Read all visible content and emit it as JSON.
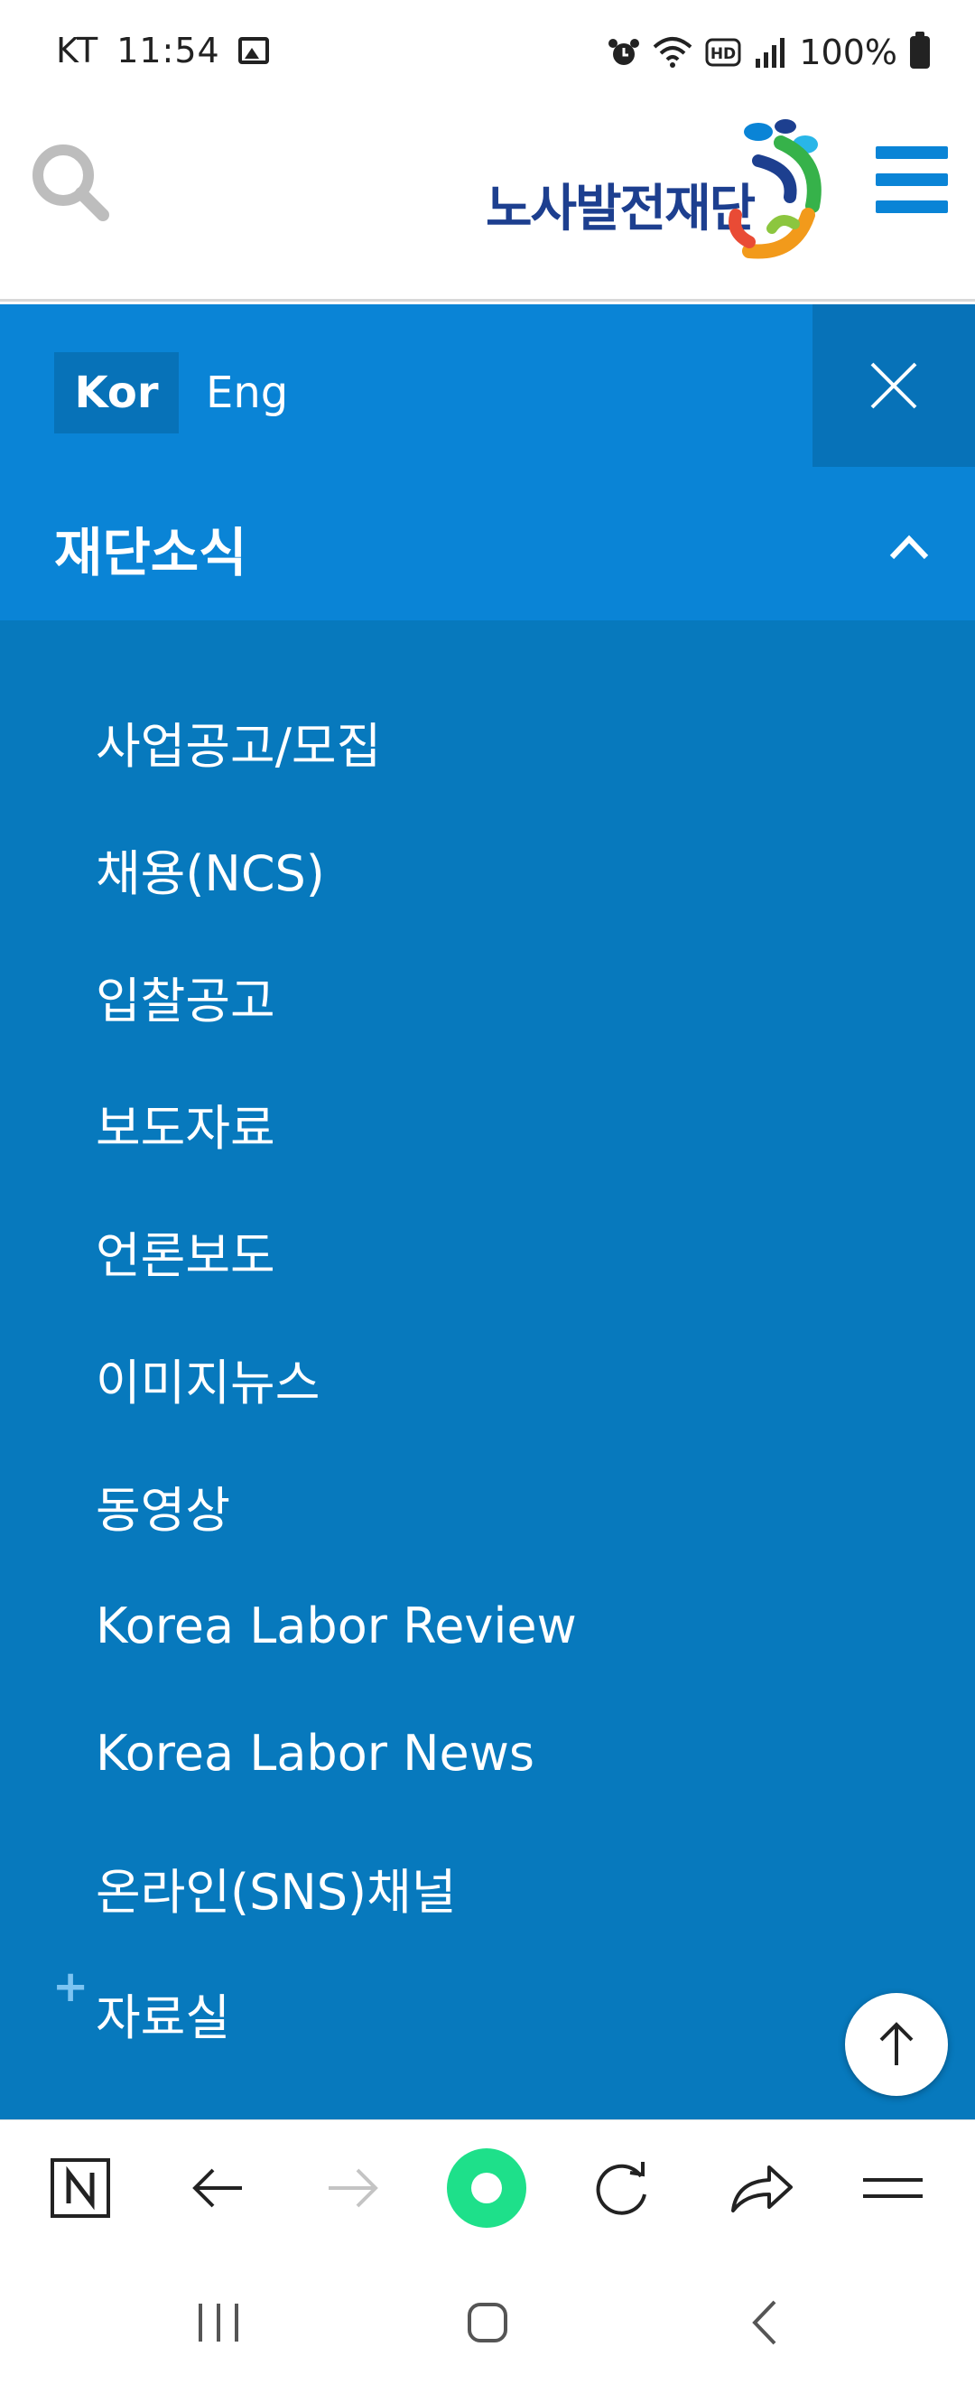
{
  "status_bar": {
    "carrier": "KT",
    "time": "11:54",
    "battery": "100%",
    "icons": [
      "image-icon",
      "alarm-icon",
      "wifi-icon",
      "hd-icon",
      "signal-icon",
      "battery-icon"
    ]
  },
  "header": {
    "logo_text": "노사발전재단",
    "icons": [
      "search-icon",
      "hamburger-menu-icon"
    ],
    "brand_color": "#1d3f8f"
  },
  "menu": {
    "lang_kor": "Kor",
    "lang_eng": "Eng",
    "section_title": "재단소식",
    "items": [
      "사업공고/모집",
      "채용(NCS)",
      "입찰공고",
      "보도자료",
      "언론보도",
      "이미지뉴스",
      "동영상",
      "Korea Labor Review",
      "Korea Labor News",
      "온라인(SNS)채널"
    ],
    "plus_prefix": "+",
    "collapsed_section": "자료실",
    "colors": {
      "primary": "#0a84d6",
      "dark": "#0779bd",
      "accent": "#0772b8"
    }
  },
  "browser_toolbar": {
    "icons": [
      "naver-n-icon",
      "back-arrow-icon",
      "forward-arrow-icon",
      "home-dot-icon",
      "refresh-icon",
      "share-icon",
      "menu-lines-icon"
    ]
  },
  "system_nav": {
    "icons": [
      "recent-apps-icon",
      "home-icon",
      "back-icon"
    ]
  }
}
